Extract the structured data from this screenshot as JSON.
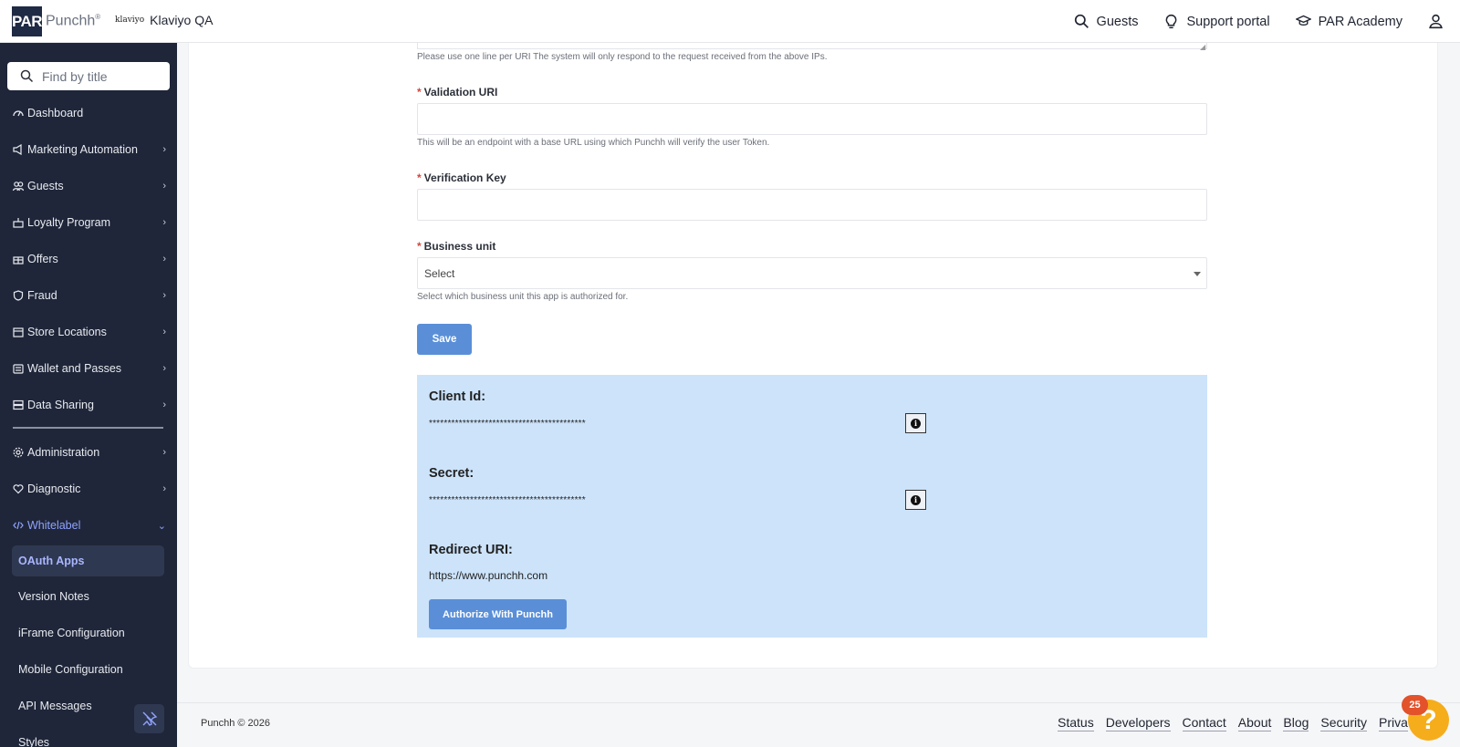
{
  "header": {
    "logo_mark": "PAR",
    "logo_text": "Punchh",
    "brand_mark": "klaviyo",
    "business_name": "Klaviyo QA",
    "links": {
      "guests": "Guests",
      "support": "Support portal",
      "academy": "PAR Academy"
    }
  },
  "sidebar": {
    "search_placeholder": "Find by title",
    "items": [
      {
        "label": "Dashboard",
        "icon": "dashboard-icon"
      },
      {
        "label": "Marketing Automation",
        "icon": "megaphone-icon"
      },
      {
        "label": "Guests",
        "icon": "users-icon"
      },
      {
        "label": "Loyalty Program",
        "icon": "cake-icon"
      },
      {
        "label": "Offers",
        "icon": "gift-icon"
      },
      {
        "label": "Fraud",
        "icon": "shield-icon"
      },
      {
        "label": "Store Locations",
        "icon": "store-icon"
      },
      {
        "label": "Wallet and Passes",
        "icon": "wallet-icon"
      },
      {
        "label": "Data Sharing",
        "icon": "database-icon"
      },
      {
        "label": "Administration",
        "icon": "gear-icon"
      },
      {
        "label": "Diagnostic",
        "icon": "heart-pulse-icon"
      },
      {
        "label": "Whitelabel",
        "icon": "code-icon"
      }
    ],
    "subitems": [
      "OAuth Apps",
      "Version Notes",
      "iFrame Configuration",
      "Mobile Configuration",
      "API Messages",
      "Styles"
    ]
  },
  "form": {
    "whitelist_help": "Please use one line per URI The system will only respond to the request received from the above IPs.",
    "validation_uri": {
      "label": "Validation URI",
      "value": "",
      "help": "This will be an endpoint with a base URL using which Punchh will verify the user Token."
    },
    "verification_key": {
      "label": "Verification Key",
      "value": ""
    },
    "business_unit": {
      "label": "Business unit",
      "selected": "Select",
      "help": "Select which business unit this app is authorized for."
    },
    "required_mark": "*",
    "save_label": "Save"
  },
  "credentials": {
    "client_id_title": "Client Id:",
    "client_id_mask": "******************************************",
    "secret_title": "Secret:",
    "secret_mask": "******************************************",
    "redirect_title": "Redirect URI:",
    "redirect_value": "https://www.punchh.com",
    "authorize_label": "Authorize With Punchh"
  },
  "footer": {
    "copyright": "Punchh © 2026",
    "links": [
      "Status",
      "Developers",
      "Contact",
      "About",
      "Blog",
      "Security",
      "Priva"
    ],
    "help_badge": "25",
    "help_glyph": "?"
  },
  "colors": {
    "sidebar_bg": "#1f2639",
    "accent": "#5a8fd8",
    "panel_bg": "#cce3fa",
    "active_nav": "#8fa3ff"
  }
}
